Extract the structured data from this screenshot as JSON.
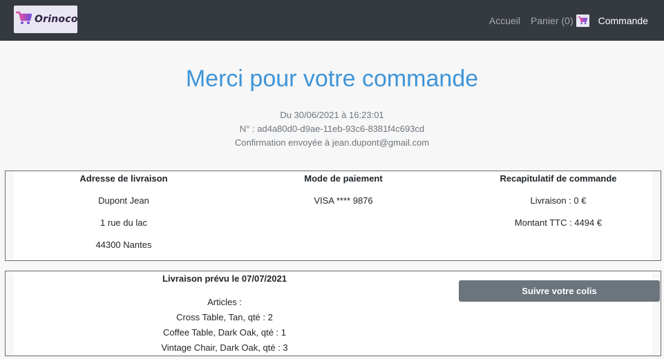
{
  "header": {
    "logo_text": "Orinoco",
    "nav": {
      "home": "Accueil",
      "cart": "Panier",
      "cart_count": "(0)",
      "order": "Commande"
    }
  },
  "hero": {
    "title": "Merci pour votre commande",
    "date_line": "Du 30/06/2021 à 16:23:01",
    "order_number_line": "N° : ad4a80d0-d9ae-11eb-93c6-8381f4c693cd",
    "confirmation_line": "Confirmation envoyée à jean.dupont@gmail.com"
  },
  "shipping_address": {
    "heading": "Adresse de livraison",
    "name": "Dupont Jean",
    "street": "1 rue du lac",
    "city": "44300 Nantes"
  },
  "payment": {
    "heading": "Mode de paiement",
    "card": "VISA **** 9876"
  },
  "summary": {
    "heading": "Recapitulatif de commande",
    "delivery_cost": "Livraison : 0 €",
    "total": "Montant TTC : 4494 €"
  },
  "delivery": {
    "heading": "Livraison prévu le 07/07/2021",
    "articles_label": "Articles :",
    "articles": [
      "Cross Table, Tan, qté : 2",
      "Coffee Table, Dark Oak, qté : 1",
      "Vintage Chair, Dark Oak, qté : 3"
    ],
    "track_button": "Suivre votre colis"
  },
  "colors": {
    "navbar": "#343a40",
    "title_blue": "#3e95d8",
    "button_gray": "#6c757d"
  },
  "icons": {
    "logo": "shopping-cart-icon",
    "cart": "shopping-cart-icon"
  }
}
